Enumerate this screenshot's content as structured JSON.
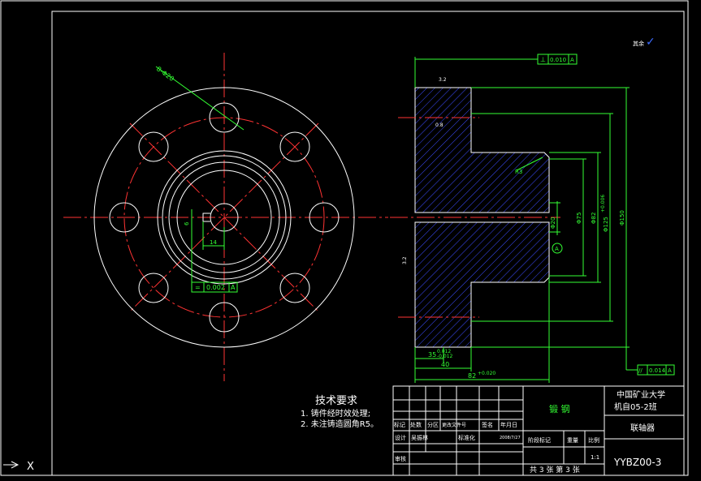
{
  "notes": {
    "title": "技术要求",
    "items": [
      "1. 铸件经时效处理;",
      "2. 未注铸造圆角R5。"
    ]
  },
  "left_view": {
    "hole_callout": "8-Φ20",
    "dim_s": "6",
    "dim_l4": "14",
    "gdt_sym": "=",
    "gdt_val": "0.002",
    "gdt_datum": "A"
  },
  "right_view": {
    "gdt_top_sym": "⊥",
    "gdt_top_val": "0.010",
    "gdt_top_datum": "A",
    "gdt_bot_sym": "//",
    "gdt_bot_val": "0.014",
    "gdt_bot_datum": "A",
    "dim_35": "35",
    "dim_35_tol_up": "0.012",
    "dim_35_tol_dn": "-0.012",
    "dim_40": "40",
    "dim_82": "82",
    "dim_82_tol": "+0.020",
    "dim_r3": "R3",
    "dia_20": "Φ20",
    "dia_75": "Φ75",
    "dia_82": "Φ82",
    "dia_125": "Φ125",
    "dia_125_tol": "+0.006",
    "dia_150": "Φ150",
    "datum": "A",
    "rough_top": "3.2",
    "rough_mid": "0.8",
    "rough_left": "3.2"
  },
  "surface_mark": {
    "label": "其余",
    "symbol": "✓"
  },
  "title_block": {
    "material": "锻 钢",
    "school": "中国矿业大学",
    "class_name": "机自05-2班",
    "part_name": "联轴器",
    "drawing_no": "YYBZ00-3",
    "sheet": "共 3 张 第 3 张",
    "scale": "1:1",
    "headers": [
      "标记",
      "处数",
      "分区",
      "更改文件号",
      "签名",
      "年月日"
    ],
    "row_design": [
      "设计",
      "吴振林",
      "标准化"
    ],
    "design_date": "2008/7/27",
    "row_stage": [
      "阶段标记",
      "重量",
      "比例"
    ],
    "row_review": "审核"
  },
  "ucs": {
    "axis": "X"
  }
}
